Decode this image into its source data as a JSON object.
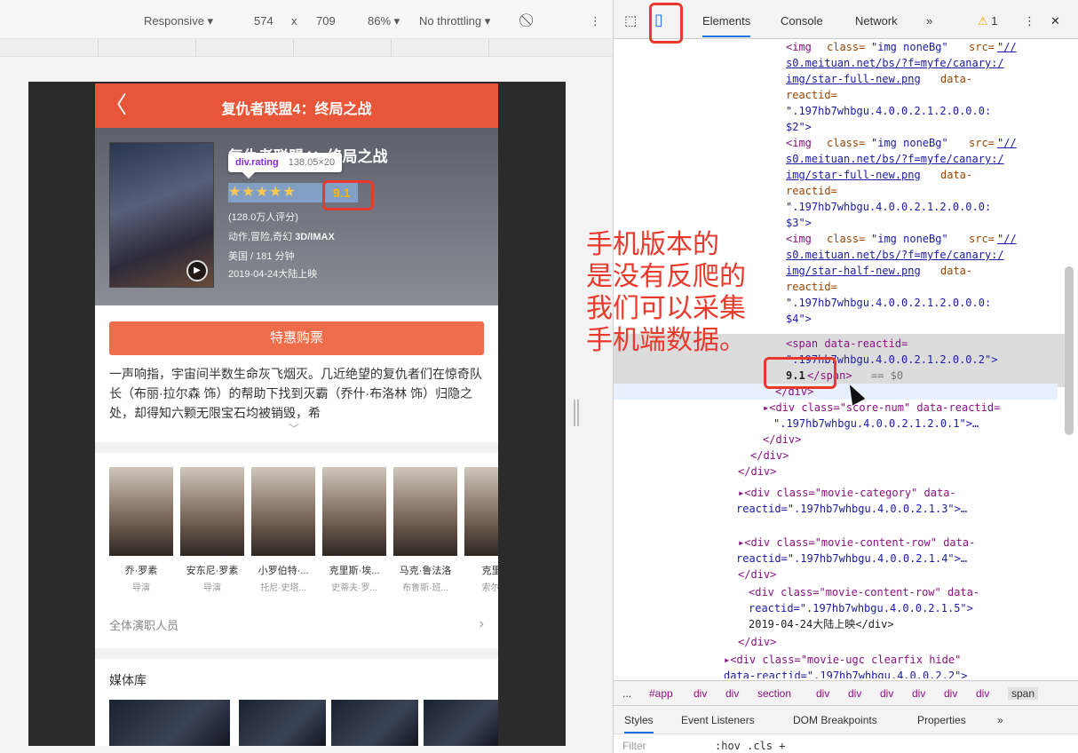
{
  "device_toolbar": {
    "device": "Responsive ▾",
    "width": "574",
    "times": "x",
    "height": "709",
    "zoom": "86% ▾",
    "throttling": "No throttling ▾",
    "rotate_icon": "⃠",
    "more_icon": "⋮"
  },
  "app": {
    "back_icon": "〈",
    "title": "复仇者联盟4：终局之战",
    "movie_name": "复仇者联盟4：终局之战",
    "tooltip_label": "div.rating",
    "tooltip_size": "138.05×20",
    "stars": "★★★★★",
    "score": "9.1",
    "rating_count": "(128.0万人评分)",
    "genres": "动作,冒险,奇幻",
    "format": "3D/IMAX",
    "region_duration": "美国 / 181 分钟",
    "release": "2019-04-24大陆上映",
    "play_icon": "▶",
    "buy_button": "特惠购票",
    "synopsis": "一声响指，宇宙间半数生命灰飞烟灭。几近绝望的复仇者们在惊奇队长（布丽·拉尔森 饰）的帮助下找到灭霸（乔什·布洛林 饰）归隐之处，却得知六颗无限宝石均被销毁，希",
    "expand_icon": "﹀",
    "cast": [
      {
        "name": "乔·罗素",
        "role": "导演"
      },
      {
        "name": "安东尼·罗素",
        "role": "导演"
      },
      {
        "name": "小罗伯特·...",
        "role": "托尼·史塔..."
      },
      {
        "name": "克里斯·埃...",
        "role": "史蒂夫·罗..."
      },
      {
        "name": "马克·鲁法洛",
        "role": "布鲁斯·班..."
      },
      {
        "name": "克里斯",
        "role": "索尔/雷"
      }
    ],
    "all_cast": "全体演职人员",
    "all_cast_arrow": "›",
    "media_title": "媒体库"
  },
  "annotation": {
    "lines": [
      "手机版本的",
      "是没有反爬的",
      "我们可以采集",
      "手机端数据。"
    ]
  },
  "devtools": {
    "inspect_icon": "⬚",
    "device_icon": "▯",
    "tabs": [
      "Elements",
      "Console",
      "Network",
      "»"
    ],
    "warning_icon": "⚠",
    "warning_count": "1",
    "menu_icon": "⋮",
    "close_icon": "✕",
    "dom": {
      "img1_open": "<img",
      "img_class_attr": "class=",
      "img_class_val": "\"img noneBg\"",
      "img_src_attr": "src=",
      "url_line1": "s0.meituan.net/bs/?f=myfe/canary:/",
      "url_full": "img/star-full-new.png",
      "url_half": "img/star-half-new.png",
      "data_attr": "data-",
      "reactid_attr": "reactid=",
      "r_s2": "\".197hb7whbgu.4.0.0.2.1.2.0.0.0:",
      "s2": "$2\">",
      "s3": "$3\">",
      "s4": "$4\">",
      "src_slashes": "\"//",
      "span_open": "<span data-reactid=",
      "span_reactid": "\".197hb7whbgu.4.0.0.2.1.2.0.0.2\">",
      "span_text": "9.1",
      "span_close": "</span>",
      "eq0": "== $0",
      "div_close": "</div>",
      "score_num": "▸<div class=\"score-num\" data-reactid=",
      "score_num_id": "\".197hb7whbgu.4.0.0.2.1.2.0.1\">…",
      "movie_category": "▸<div class=\"movie-category\" data-",
      "movie_category_id": "reactid=\".197hb7whbgu.4.0.0.2.1.3\">…",
      "content_row1": "▸<div class=\"movie-content-row\" data-",
      "content_row1_id": "reactid=\".197hb7whbgu.4.0.0.2.1.4\">…",
      "content_row2": "<div class=\"movie-content-row\" data-",
      "content_row2_id": "reactid=\".197hb7whbgu.4.0.0.2.1.5\">",
      "release_text": "2019-04-24大陆上映</div>",
      "ugc": "▸<div class=\"movie-ugc clearfix hide\"",
      "ugc_id": "data-reactid=\".197hb7whbgu.4.0.0.2.2\">"
    },
    "breadcrumbs": [
      "...",
      "#app",
      "div",
      "div",
      "section",
      "div",
      "div",
      "div",
      "div",
      "div",
      "div",
      "span"
    ],
    "sub_tabs": [
      "Styles",
      "Event Listeners",
      "DOM Breakpoints",
      "Properties",
      "»"
    ],
    "filter_placeholder": "Filter",
    "hov_cls": ":hov  .cls  +"
  },
  "colors": {
    "accent": "#e8563a",
    "annotation_red": "#e8392c",
    "devtools_tag": "#881280",
    "devtools_attr": "#994500"
  }
}
